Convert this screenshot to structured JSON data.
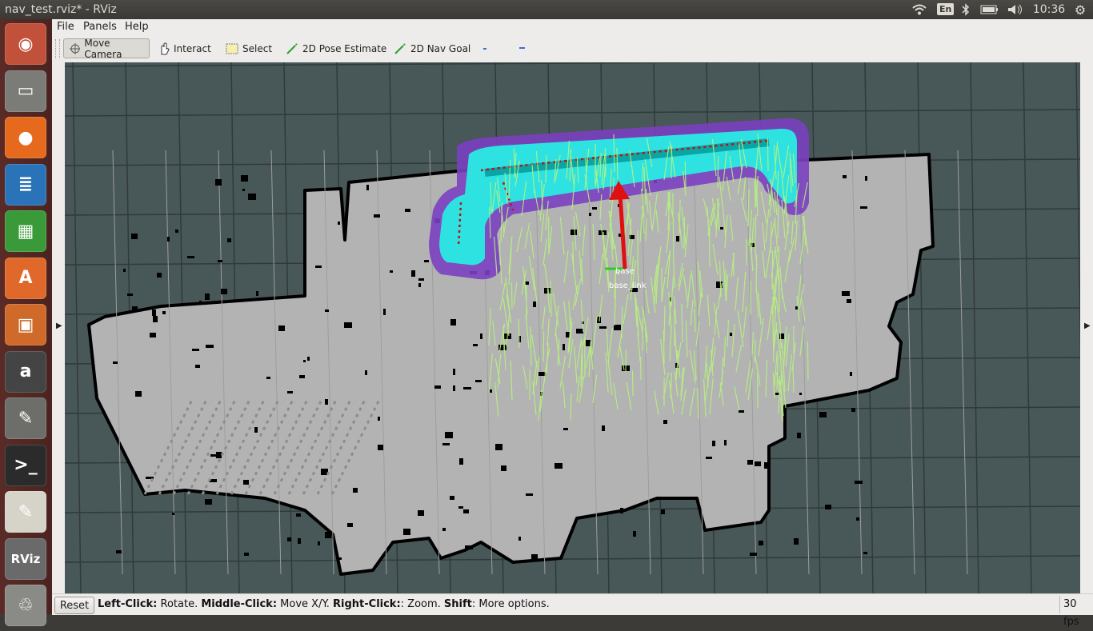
{
  "window_title": "nav_test.rviz* - RViz",
  "tray": {
    "lang": "En",
    "clock": "10:36",
    "icons": [
      "wifi-icon",
      "keyboard-lang-icon",
      "bluetooth-icon",
      "battery-icon",
      "volume-icon",
      "gear-icon"
    ]
  },
  "launcher": {
    "items": [
      {
        "name": "ubuntu-dash",
        "glyph": "◉",
        "color": "#c1513a"
      },
      {
        "name": "files",
        "glyph": "▭",
        "color": "#7b7b78"
      },
      {
        "name": "firefox",
        "glyph": "●",
        "color": "#e66a1d"
      },
      {
        "name": "writer",
        "glyph": "≣",
        "color": "#2b73b8"
      },
      {
        "name": "calc",
        "glyph": "▦",
        "color": "#3a9a3a"
      },
      {
        "name": "software-center",
        "glyph": "A",
        "color": "#e0682a"
      },
      {
        "name": "impress",
        "glyph": "▣",
        "color": "#cf6a2a"
      },
      {
        "name": "amazon",
        "glyph": "a",
        "color": "#444444"
      },
      {
        "name": "system-settings",
        "glyph": "✎",
        "color": "#6d6d6a"
      },
      {
        "name": "terminal",
        "glyph": ">_",
        "color": "#2b2b2b"
      },
      {
        "name": "text-editor",
        "glyph": "✎",
        "color": "#d6d3c9"
      },
      {
        "name": "rviz",
        "glyph": "RViz",
        "color": "#6a6a6a"
      },
      {
        "name": "trash",
        "glyph": "♲",
        "color": "#8a8a86"
      }
    ]
  },
  "menus": [
    "File",
    "Panels",
    "Help"
  ],
  "toolbar": {
    "move_camera": "Move Camera",
    "interact": "Interact",
    "select": "Select",
    "pose_estimate": "2D Pose Estimate",
    "nav_goal": "2D Nav Goal"
  },
  "viewport": {
    "frame_labels": [
      "base",
      "base_link"
    ],
    "colors": {
      "background": "#485757",
      "free": "#b3b3b3",
      "occupied": "#000000",
      "costmap_inner": "#2fe2e2",
      "costmap_outer": "#7a40c0",
      "particles": "#b6f57a",
      "robot_arrow": "#e01010"
    }
  },
  "statusbar": {
    "reset": "Reset",
    "hint_parts": [
      {
        "b": "Left-Click:",
        "t": " Rotate. "
      },
      {
        "b": "Middle-Click:",
        "t": " Move X/Y. "
      },
      {
        "b": "Right-Click:",
        "t": ": Zoom. "
      },
      {
        "b": "Shift",
        "t": ": More options."
      }
    ],
    "fps": "30 fps"
  }
}
